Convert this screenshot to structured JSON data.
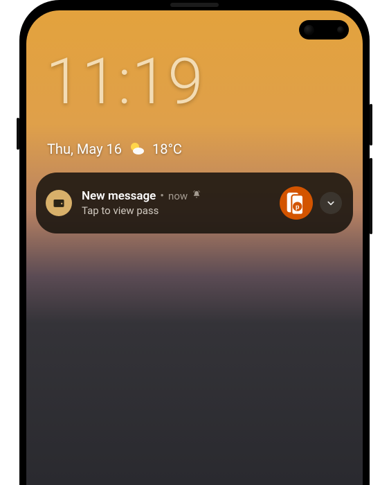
{
  "clock": {
    "time": "11:19"
  },
  "date_row": {
    "date": "Thu, May 16",
    "temperature": "18°C"
  },
  "notification": {
    "title": "New message",
    "separator": "•",
    "time_label": "now",
    "body": "Tap to view pass"
  }
}
